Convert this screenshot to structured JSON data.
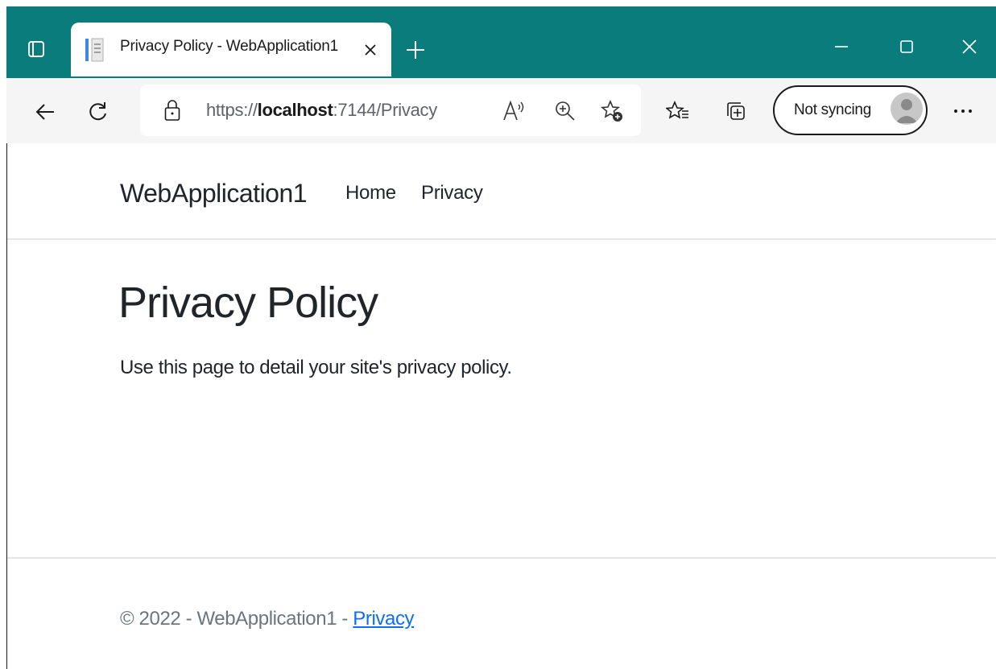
{
  "browser": {
    "tab": {
      "title": "Privacy Policy - WebApplication1"
    },
    "address": {
      "scheme": "https://",
      "host": "localhost",
      "rest": ":7144/Privacy"
    },
    "profile": {
      "label": "Not syncing"
    },
    "colors": {
      "titlebar": "#0a7c7b",
      "toolbar": "#f5f5f5"
    }
  },
  "site": {
    "brand": "WebApplication1",
    "nav": [
      {
        "label": "Home"
      },
      {
        "label": "Privacy"
      }
    ]
  },
  "main": {
    "heading": "Privacy Policy",
    "text": "Use this page to detail your site's privacy policy."
  },
  "footer": {
    "text": "© 2022 - WebApplication1 - ",
    "link": "Privacy",
    "link_color": "#0d6efd"
  }
}
